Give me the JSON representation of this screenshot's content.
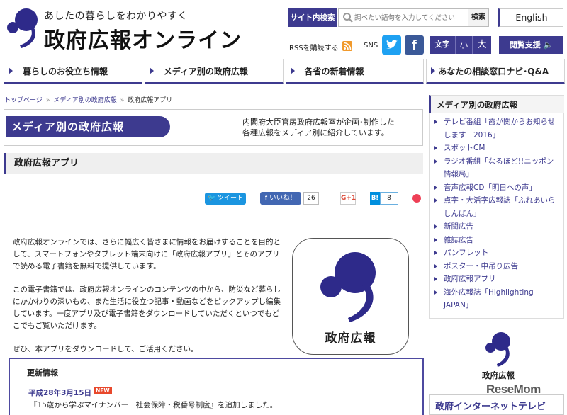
{
  "header": {
    "tagline": "あしたの暮らしをわかりやすく",
    "site_title": "政府広報オンライン",
    "search_label": "サイト内検索",
    "search_placeholder": "調べたい語句を入力してください",
    "search_button": "検索",
    "english_button": "English",
    "rss_label": "RSSを購読する",
    "sns_label": "SNS",
    "facebook_glyph": "f",
    "text_size_label": "文字",
    "text_size_small": "小",
    "text_size_large": "大",
    "reading_support": "閲覧支援 🔈"
  },
  "nav": {
    "items": [
      "暮らしのお役立ち情報",
      "メディア別の政府広報",
      "各省の新着情報",
      "あなたの相談窓口ナビ･Q&A"
    ]
  },
  "breadcrumb": {
    "home": "トップページ",
    "media": "メディア別の政府広報",
    "current": "政府広報アプリ"
  },
  "banner": {
    "label": "メディア別の政府広報",
    "desc_line1": "内閣府大臣官房政府広報室が企画･制作した",
    "desc_line2": "各種広報をメディア別に紹介しています。"
  },
  "section": {
    "title": "政府広報アプリ"
  },
  "share": {
    "tweet": "ツイート",
    "like": "いいね！",
    "like_count": "26",
    "google": "G+1",
    "hatena": "B!",
    "hatena_count": "8"
  },
  "intro": {
    "p1": "政府広報オンラインでは、さらに幅広く皆さまに情報をお届けすることを目的として、スマートフォンやタブレット端末向けに「政府広報アプリ」とそのアプリで読める電子書籍を無料で提供しています。",
    "p2": "この電子書籍では、政府広報オンラインのコンテンツの中から、防災など暮らしにかかわりの深いもの、また生活に役立つ記事・動画などをピックアップし編集しています。一度アプリ及び電子書籍をダウンロードしていただくといつでもどこでもご覧いただけます。",
    "p3": "ぜひ、本アプリをダウンロードして、ご活用ください。"
  },
  "app_icon": {
    "label": "政府広報"
  },
  "update": {
    "title": "更新情報",
    "date": "平成28年3月15日",
    "badge": "NEW",
    "text": "『15歳から学ぶマイナンバー　社会保障・税番号制度』を追加しました。"
  },
  "sidebar": {
    "title": "メディア別の政府広報",
    "items": [
      "テレビ番組「霞が関からお知らせします　2016」",
      "スポットCM",
      "ラジオ番組「なるほど!!ニッポン情報局」",
      "音声広報CD「明日への声」",
      "点字・大活字広報誌「ふれあいらしんばん」",
      "新聞広告",
      "雑誌広告",
      "パンフレット",
      "ポスター・中吊り広告",
      "政府広報アプリ",
      "海外広報誌「Highlighting JAPAN」"
    ],
    "logo_label": "政府広報",
    "tv_banner": "政府インターネットテレビ"
  },
  "watermark": "ReseMom",
  "colors": {
    "brand": "#3d3a8f",
    "twitter": "#1ea1f2",
    "facebook": "#3b5998",
    "new_badge": "#e8482c"
  }
}
